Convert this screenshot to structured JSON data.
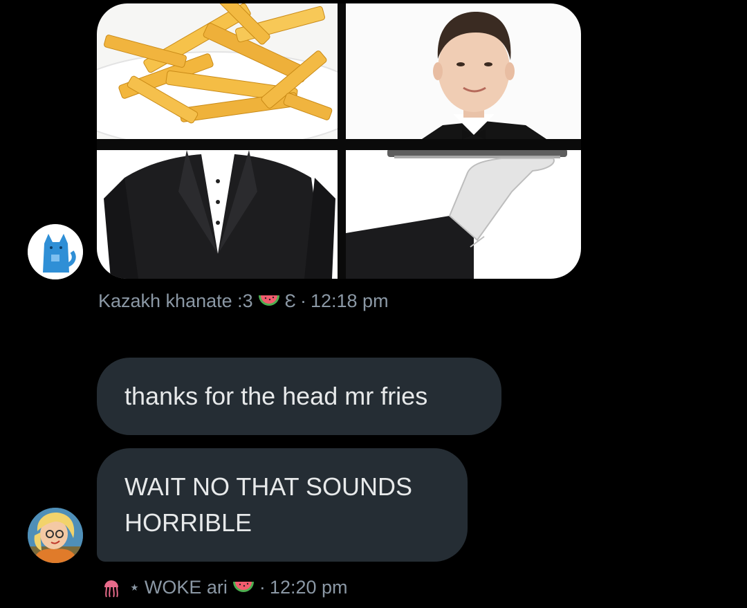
{
  "messages": [
    {
      "type": "image",
      "images": [
        "fries",
        "waiter-face",
        "suit-body",
        "gloved-hand-with-tray"
      ],
      "sender": "Kazakh khanate :3",
      "sender_suffix": "Ɛ",
      "sender_emoji": "watermelon-icon",
      "separator": "·",
      "time": "12:18 pm",
      "avatar": "blue-cat-avatar"
    },
    {
      "type": "text",
      "lines": [
        "thanks for the head mr fries"
      ]
    },
    {
      "type": "text",
      "lines": [
        "WAIT NO THAT SOUNDS",
        "HORRIBLE"
      ],
      "sender_prefix_emoji": "jellyfish-icon",
      "sender_prefix": "⋆",
      "sender": "WOKE ari",
      "sender_emoji": "watermelon-icon",
      "separator": "·",
      "time": "12:20 pm",
      "avatar": "cartoon-blonde-avatar"
    }
  ],
  "colors": {
    "background": "#000000",
    "bubble": "#252d34",
    "text": "#e7e9ea",
    "meta": "#8b98a5"
  }
}
